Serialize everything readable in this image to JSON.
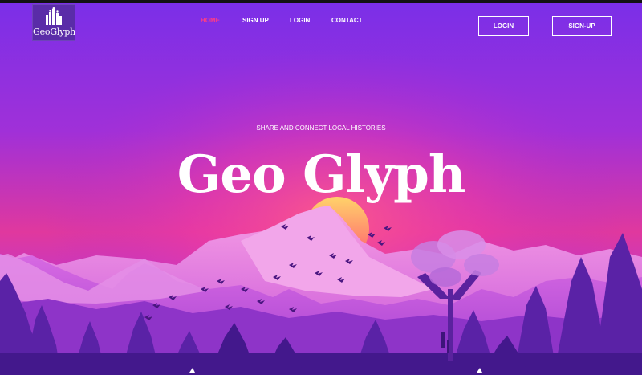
{
  "brand": {
    "logo_text": "GeoGlyph"
  },
  "nav": {
    "items": [
      {
        "label": "HOME",
        "active": true
      },
      {
        "label": "SIGN UP",
        "active": false
      },
      {
        "label": "LOGIN",
        "active": false
      },
      {
        "label": "CONTACT",
        "active": false
      }
    ]
  },
  "header_buttons": {
    "login": "LOGIN",
    "signup": "SIGN-UP"
  },
  "hero": {
    "tagline": "SHARE AND CONNECT LOCAL HISTORIES",
    "title": "Geo Glyph"
  },
  "colors": {
    "active_nav": "#ff3c84",
    "sky_top": "#7b2ee6",
    "sky_glow": "#f0409a",
    "sun": "#ff9a4d"
  }
}
